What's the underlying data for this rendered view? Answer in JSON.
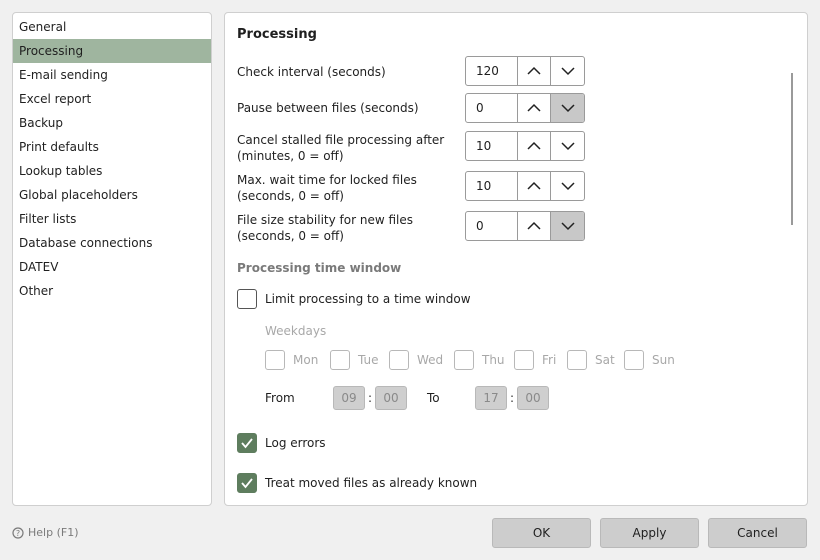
{
  "sidebar": {
    "items": [
      {
        "label": "General"
      },
      {
        "label": "Processing"
      },
      {
        "label": "E-mail sending"
      },
      {
        "label": "Excel report"
      },
      {
        "label": "Backup"
      },
      {
        "label": "Print defaults"
      },
      {
        "label": "Lookup tables"
      },
      {
        "label": "Global placeholders"
      },
      {
        "label": "Filter lists"
      },
      {
        "label": "Database connections"
      },
      {
        "label": "DATEV"
      },
      {
        "label": "Other"
      }
    ],
    "active": "Processing"
  },
  "panel": {
    "title": "Processing",
    "fields": [
      {
        "label": "Check interval (seconds)",
        "value": "120"
      },
      {
        "label": "Pause between files (seconds)",
        "value": "0"
      },
      {
        "label": "Cancel stalled file processing after (minutes, 0 = off)",
        "value": "10"
      },
      {
        "label": "Max. wait time for locked files (seconds, 0 = off)",
        "value": "10"
      },
      {
        "label": "File size stability for new files (seconds, 0 = off)",
        "value": "0"
      }
    ],
    "time_window": {
      "section_title": "Processing time window",
      "limit_label": "Limit processing to a time window",
      "limit_checked": false,
      "weekdays_label": "Weekdays",
      "weekdays": [
        "Mon",
        "Tue",
        "Wed",
        "Thu",
        "Fri",
        "Sat",
        "Sun"
      ],
      "from_label": "From",
      "from_hour": "09",
      "from_minute": "00",
      "to_label": "To",
      "to_hour": "17",
      "to_minute": "00",
      "separator": ":"
    },
    "log_errors_label": "Log errors",
    "log_errors_checked": true,
    "treat_moved_label": "Treat moved files as already known",
    "treat_moved_checked": true
  },
  "footer": {
    "help_label": "Help (F1)",
    "ok_label": "OK",
    "apply_label": "Apply",
    "cancel_label": "Cancel"
  },
  "colors": {
    "accent": "#5e7d5e",
    "selection": "#9fb59f"
  }
}
